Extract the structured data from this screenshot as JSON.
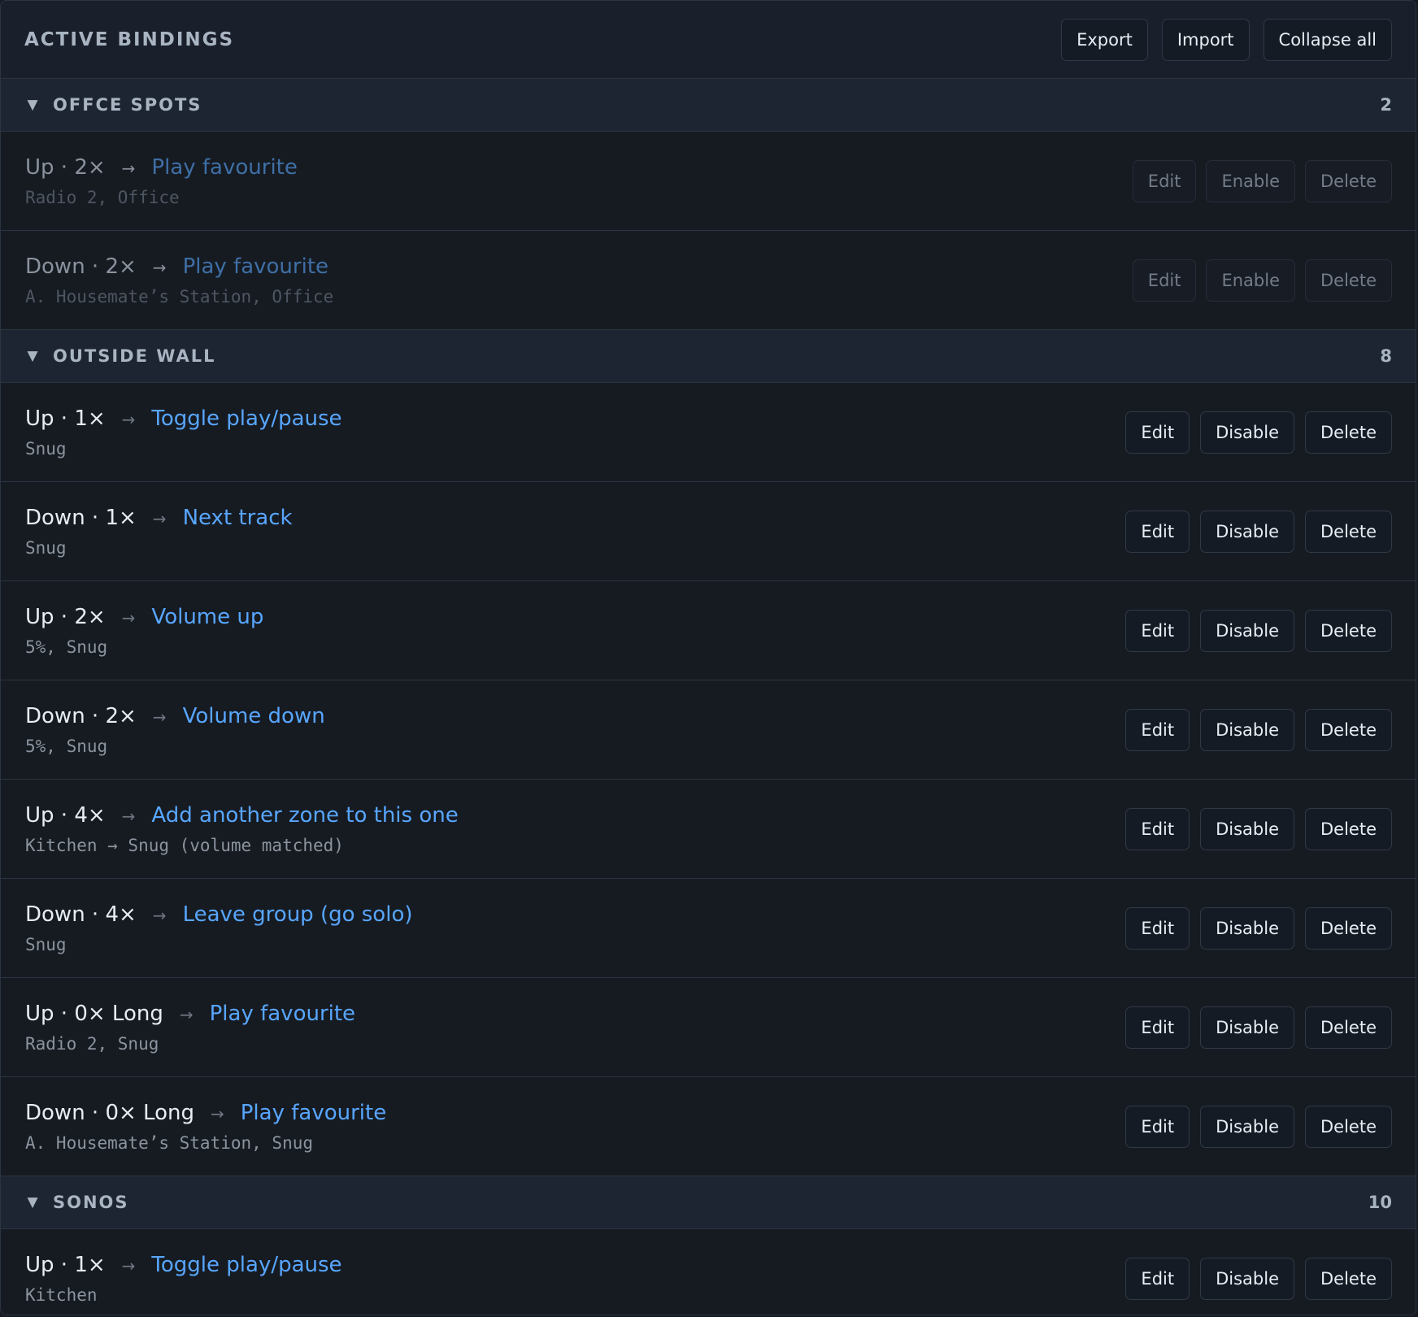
{
  "toolbar": {
    "title": "ACTIVE BINDINGS",
    "export_label": "Export",
    "import_label": "Import",
    "collapse_label": "Collapse all"
  },
  "groups": [
    {
      "name": "OFFCE SPOTS",
      "count": "2",
      "chevron": "▼",
      "rows": [
        {
          "trigger": "Up · 2×",
          "arrow": "→",
          "action": "Play favourite",
          "detail": "Radio 2, Office",
          "edit": "Edit",
          "toggle": "Enable",
          "delete": "Delete"
        },
        {
          "trigger": "Down · 2×",
          "arrow": "→",
          "action": "Play favourite",
          "detail": "A. Housemate’s Station, Office",
          "edit": "Edit",
          "toggle": "Enable",
          "delete": "Delete"
        }
      ]
    },
    {
      "name": "OUTSIDE WALL",
      "count": "8",
      "chevron": "▼",
      "rows": [
        {
          "trigger": "Up · 1×",
          "arrow": "→",
          "action": "Toggle play/pause",
          "detail": "Snug",
          "edit": "Edit",
          "toggle": "Disable",
          "delete": "Delete"
        },
        {
          "trigger": "Down · 1×",
          "arrow": "→",
          "action": "Next track",
          "detail": "Snug",
          "edit": "Edit",
          "toggle": "Disable",
          "delete": "Delete"
        },
        {
          "trigger": "Up · 2×",
          "arrow": "→",
          "action": "Volume up",
          "detail": "5%, Snug",
          "edit": "Edit",
          "toggle": "Disable",
          "delete": "Delete"
        },
        {
          "trigger": "Down · 2×",
          "arrow": "→",
          "action": "Volume down",
          "detail": "5%, Snug",
          "edit": "Edit",
          "toggle": "Disable",
          "delete": "Delete"
        },
        {
          "trigger": "Up · 4×",
          "arrow": "→",
          "action": "Add another zone to this one",
          "detail": "Kitchen → Snug (volume matched)",
          "edit": "Edit",
          "toggle": "Disable",
          "delete": "Delete"
        },
        {
          "trigger": "Down · 4×",
          "arrow": "→",
          "action": "Leave group (go solo)",
          "detail": "Snug",
          "edit": "Edit",
          "toggle": "Disable",
          "delete": "Delete"
        },
        {
          "trigger": "Up · 0× Long",
          "arrow": "→",
          "action": "Play favourite",
          "detail": "Radio 2, Snug",
          "edit": "Edit",
          "toggle": "Disable",
          "delete": "Delete"
        },
        {
          "trigger": "Down · 0× Long",
          "arrow": "→",
          "action": "Play favourite",
          "detail": "A. Housemate’s Station, Snug",
          "edit": "Edit",
          "toggle": "Disable",
          "delete": "Delete"
        }
      ]
    },
    {
      "name": "SONOS",
      "count": "10",
      "chevron": "▼",
      "rows": [
        {
          "trigger": "Up · 1×",
          "arrow": "→",
          "action": "Toggle play/pause",
          "detail": "Kitchen",
          "edit": "Edit",
          "toggle": "Disable",
          "delete": "Delete"
        }
      ]
    }
  ]
}
